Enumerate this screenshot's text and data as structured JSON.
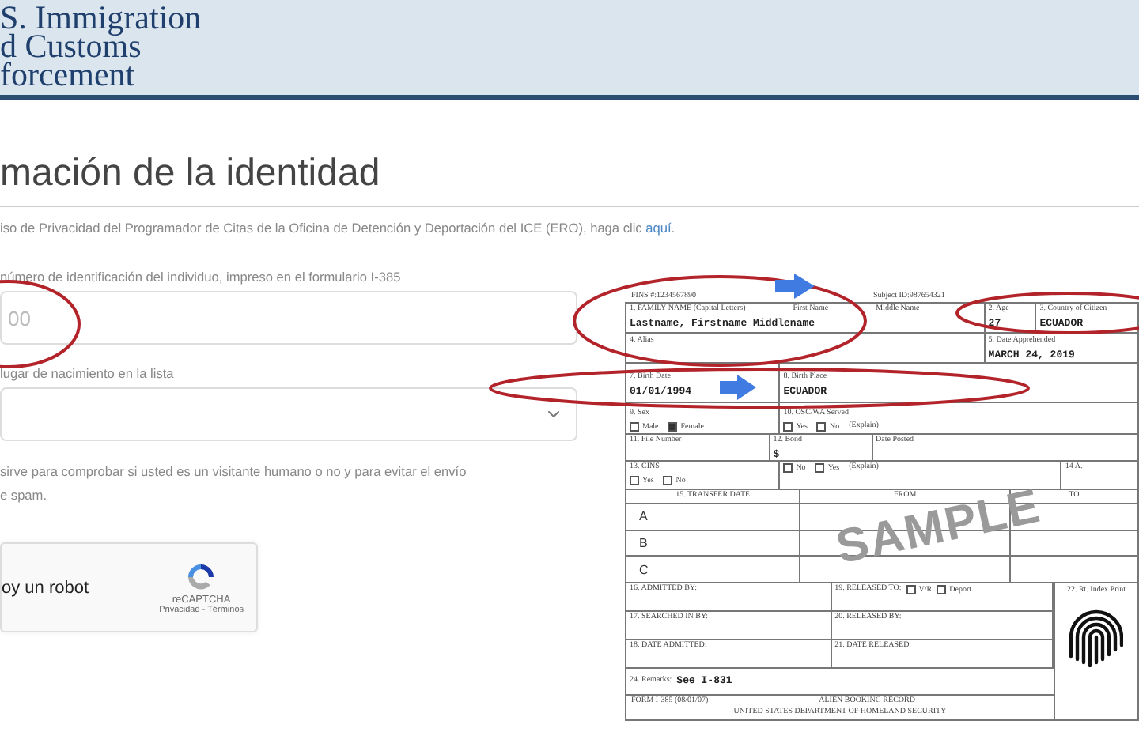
{
  "header": {
    "logo_lines": [
      "S. Immigration",
      "d Customs",
      "forcement"
    ]
  },
  "title": "mación de la identidad",
  "notice": {
    "text": "iso de Privacidad del Programador de Citas de la Oficina de Detención y Deportación del ICE (ERO), haga clic ",
    "link": "aquí",
    "end": "."
  },
  "fields": [
    {
      "kind": "input",
      "label": "número de identificación del individuo, impreso en el formulario I-385",
      "placeholder": "00"
    },
    {
      "kind": "select",
      "label": "lugar de nacimiento en la lista"
    }
  ],
  "captcha_note": [
    "sirve para comprobar si usted es un visitante humano o no y para evitar el envío",
    "e spam."
  ],
  "captcha": {
    "checkbox_label": "oy un robot",
    "brand": "reCAPTCHA",
    "links": "Privacidad - Términos"
  },
  "form": {
    "top_left": "FINS #:1234567890",
    "top_right": "Subject ID:987654321",
    "rows": [
      [
        {
          "label": "1. FAMILY NAME (Capital Letters)",
          "extra_labels": [
            "First Name",
            "Middle Name"
          ],
          "value": "Lastname, Firstname Middlename"
        },
        {
          "label": "2. Age",
          "value": "27"
        },
        {
          "label": "3. Country of Citizen",
          "value": "ECUADOR"
        }
      ],
      [
        {
          "label": "4. Alias"
        },
        {
          "label": "5. Date Apprehended",
          "value": "MARCH 24, 2019"
        }
      ],
      [
        {
          "label": "7. Birth Date",
          "value": "01/01/1994"
        },
        {
          "label": "8. Birth Place",
          "value": "ECUADOR"
        }
      ],
      [
        {
          "label": "9. Sex",
          "options": [
            {
              "label": "Male",
              "checked": false
            },
            {
              "label": "Female",
              "checked": true
            }
          ]
        },
        {
          "label": "10. OSC/WA Served",
          "options": [
            {
              "label": "Yes",
              "checked": false
            },
            {
              "label": "No",
              "checked": false
            }
          ],
          "note": "(Explain)"
        }
      ],
      [
        {
          "label": "11. File Number"
        },
        {
          "label": "12. Bond",
          "value": "$"
        },
        {
          "label": "Date Posted"
        }
      ],
      [
        {
          "label": "13. CINS",
          "options": [
            {
              "label": "Yes",
              "checked": false
            },
            {
              "label": "No",
              "checked": false
            }
          ]
        },
        {
          "options": [
            {
              "label": "No",
              "checked": false
            },
            {
              "label": "Yes",
              "checked": false
            }
          ],
          "note": "(Explain)"
        },
        {
          "label": "14 A."
        }
      ]
    ],
    "transfer": {
      "columns": [
        "15. TRANSFER DATE",
        "FROM",
        "TO"
      ],
      "rows": [
        "A",
        "B",
        "C"
      ]
    },
    "release": {
      "rows": [
        {
          "left": "16. ADMITTED BY:",
          "right": "19. RELEASED TO:",
          "options": [
            {
              "label": "V/R",
              "checked": false
            },
            {
              "label": "Deport",
              "checked": false
            }
          ]
        },
        {
          "left": "17. SEARCHED IN BY:",
          "right": "20. RELEASED BY:"
        },
        {
          "left": "18. DATE ADMITTED:",
          "right": "21. DATE RELEASED:"
        }
      ],
      "print_label": "22. Rt. Index Print"
    },
    "remarks": {
      "label": "24. Remarks:",
      "value": "See I-831"
    },
    "footer": {
      "form_number": "FORM I-385 (08/01/07)",
      "title": "ALIEN BOOKING RECORD",
      "agency": "UNITED STATES DEPARTMENT OF HOMELAND SECURITY"
    },
    "stamp": "SAMPLE"
  }
}
